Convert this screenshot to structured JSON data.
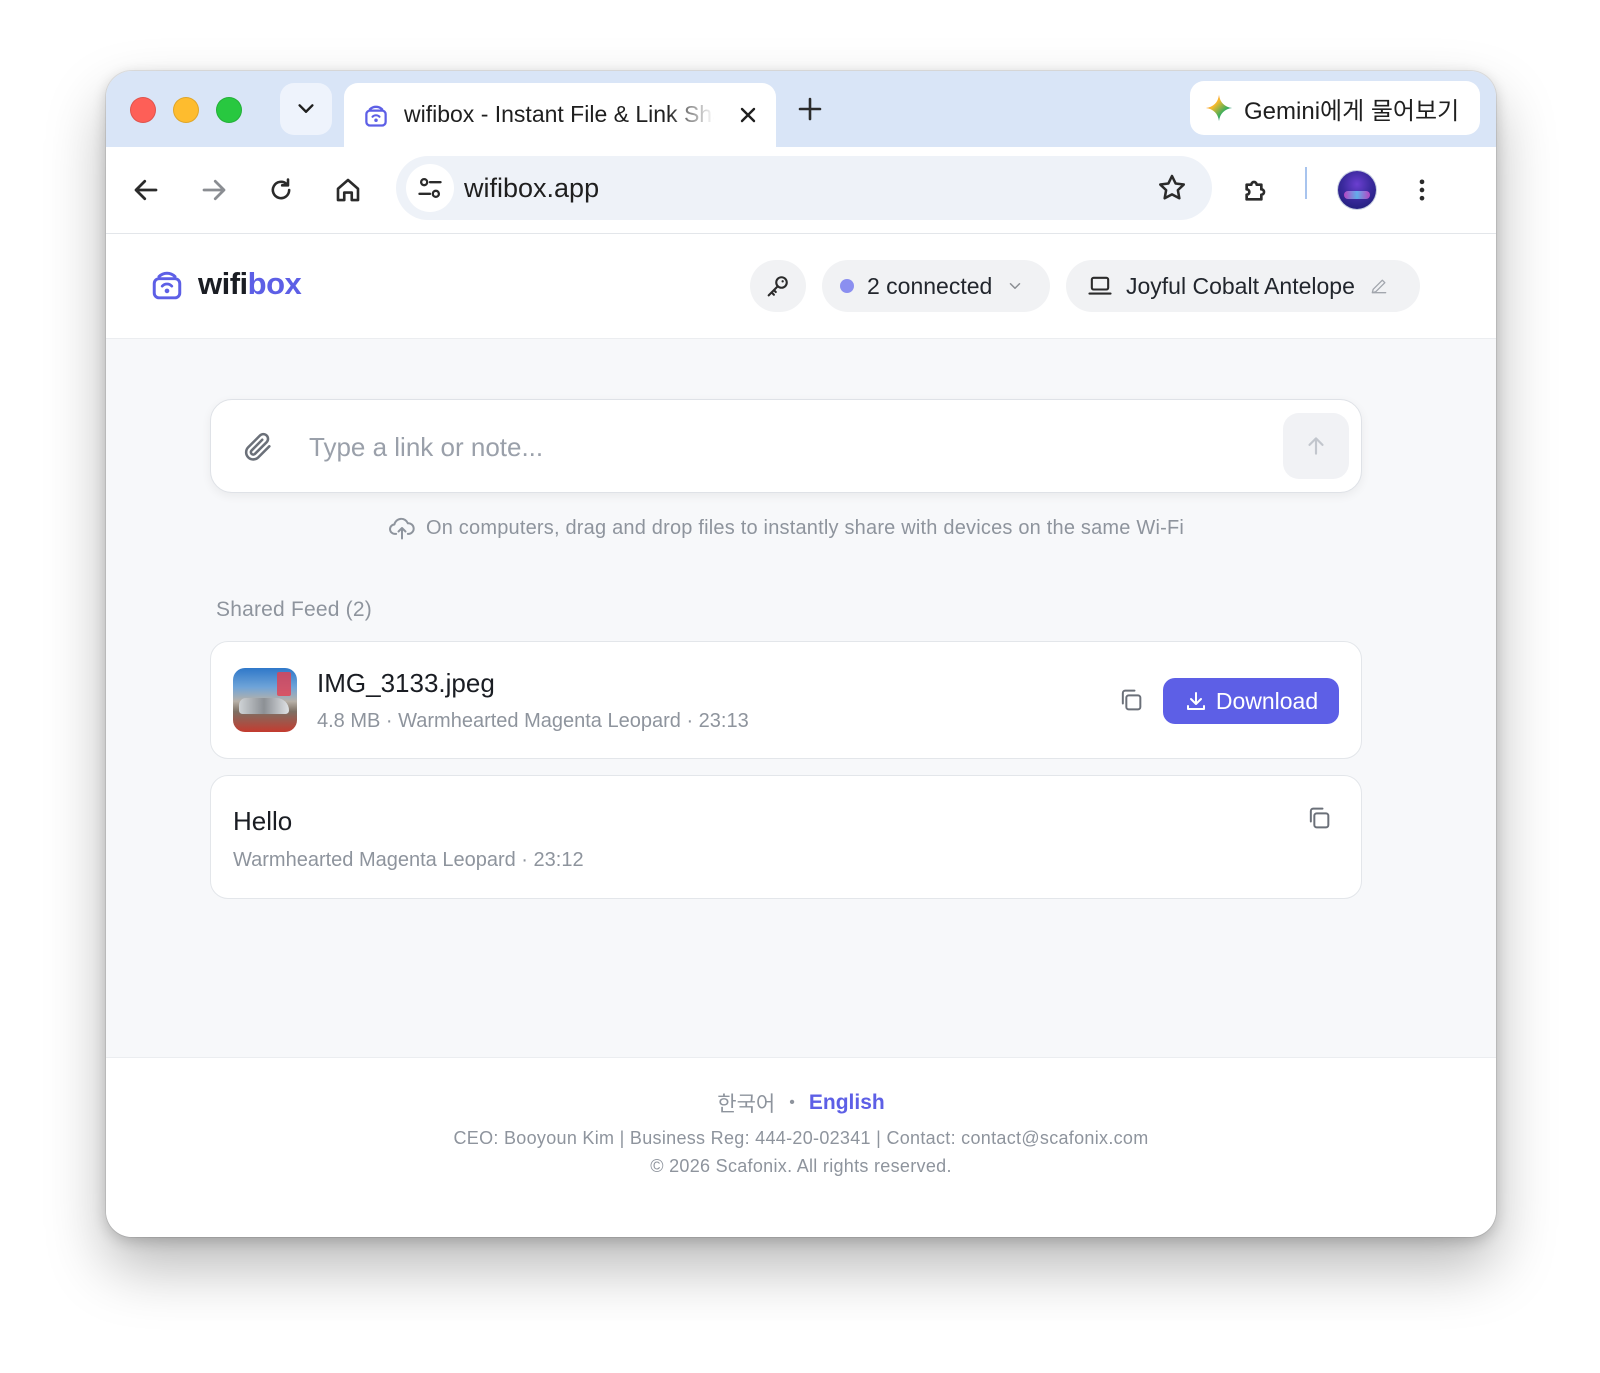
{
  "browser": {
    "tab_title": "wifibox - Instant File & Link Sharing",
    "gemini_label": "Gemini에게 물어보기",
    "url": "wifibox.app"
  },
  "header": {
    "brand_part1": "wifi",
    "brand_part2": "box",
    "connected_label": "2 connected",
    "device_name": "Joyful Cobalt Antelope"
  },
  "composer": {
    "placeholder": "Type a link or note...",
    "hint": "On computers, drag and drop files to instantly share with devices on the same Wi-Fi"
  },
  "feed": {
    "title": "Shared Feed (2)",
    "items": [
      {
        "name": "IMG_3133.jpeg",
        "meta": "4.8 MB · Warmhearted Magenta Leopard · 23:13",
        "download_label": "Download"
      },
      {
        "text": "Hello",
        "meta": "Warmhearted Magenta Leopard · 23:12"
      }
    ]
  },
  "footer": {
    "lang_ko": "한국어",
    "lang_sep": "•",
    "lang_en": "English",
    "legal": "CEO: Booyoun Kim | Business Reg: 444-20-02341 | Contact: contact@scafonix.com",
    "copyright": "© 2026 Scafonix. All rights reserved."
  },
  "colors": {
    "accent": "#5d5fe6",
    "tabstrip": "#d9e5f7",
    "page_bg": "#f7f8fa"
  },
  "icons": [
    "tab-search-icon",
    "wifibox-favicon",
    "close-icon",
    "plus-icon",
    "gemini-sparkle-icon",
    "back-arrow-icon",
    "forward-arrow-icon",
    "reload-icon",
    "home-icon",
    "site-settings-icon",
    "bookmark-star-icon",
    "extensions-puzzle-icon",
    "menu-kebab-icon",
    "key-icon",
    "chevron-down-icon",
    "laptop-icon",
    "pencil-icon",
    "paperclip-icon",
    "arrow-up-icon",
    "cloud-upload-icon",
    "copy-icon",
    "download-icon"
  ]
}
